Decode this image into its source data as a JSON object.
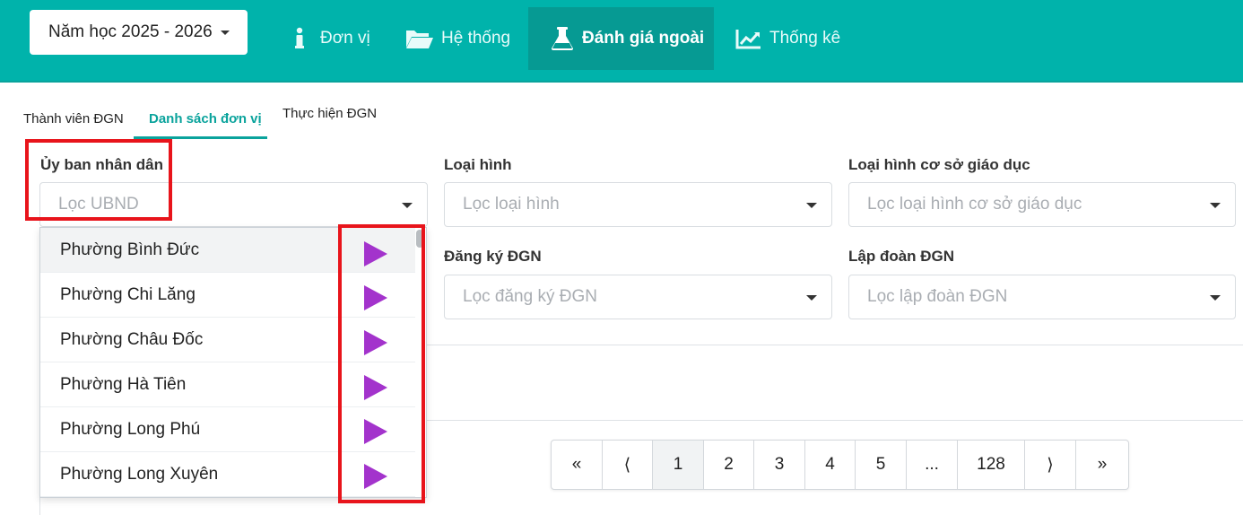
{
  "header": {
    "year_select": "Năm học 2025 - 2026",
    "nav": [
      {
        "label": "Đơn vị",
        "icon": "info-icon"
      },
      {
        "label": "Hệ thống",
        "icon": "folder-icon"
      },
      {
        "label": "Đánh giá ngoài",
        "icon": "flask-icon",
        "active": true
      },
      {
        "label": "Thống kê",
        "icon": "chart-line-icon"
      }
    ]
  },
  "tabs": [
    {
      "label": "Thành viên ĐGN"
    },
    {
      "label": "Danh sách đơn vị",
      "active": true
    },
    {
      "label": "Thực hiện ĐGN"
    }
  ],
  "filters": {
    "ubnd": {
      "label": "Ủy ban nhân dân",
      "placeholder": "Lọc UBND"
    },
    "loai_hinh": {
      "label": "Loại hình",
      "placeholder": "Lọc loại hình"
    },
    "loai_hinh_csgd": {
      "label": "Loại hình cơ sở giáo dục",
      "placeholder": "Lọc loại hình cơ sở giáo dục"
    },
    "dang_ky": {
      "label": "Đăng ký ĐGN",
      "placeholder": "Lọc đăng ký ĐGN"
    },
    "lap_doan": {
      "label": "Lập đoàn ĐGN",
      "placeholder": "Lọc lập đoàn ĐGN"
    }
  },
  "dropdown": {
    "items": [
      "Phường Bình Đức",
      "Phường Chi Lăng",
      "Phường Châu Đốc",
      "Phường Hà Tiên",
      "Phường Long Phú",
      "Phường Long Xuyên"
    ]
  },
  "pagination": [
    "«",
    "⟨",
    "1",
    "2",
    "3",
    "4",
    "5",
    "...",
    "128",
    "⟩",
    "»"
  ],
  "colors": {
    "primary": "#00b3ab",
    "active_nav": "#069a93",
    "highlight": "#e8141b",
    "arrow": "#a333cc"
  }
}
